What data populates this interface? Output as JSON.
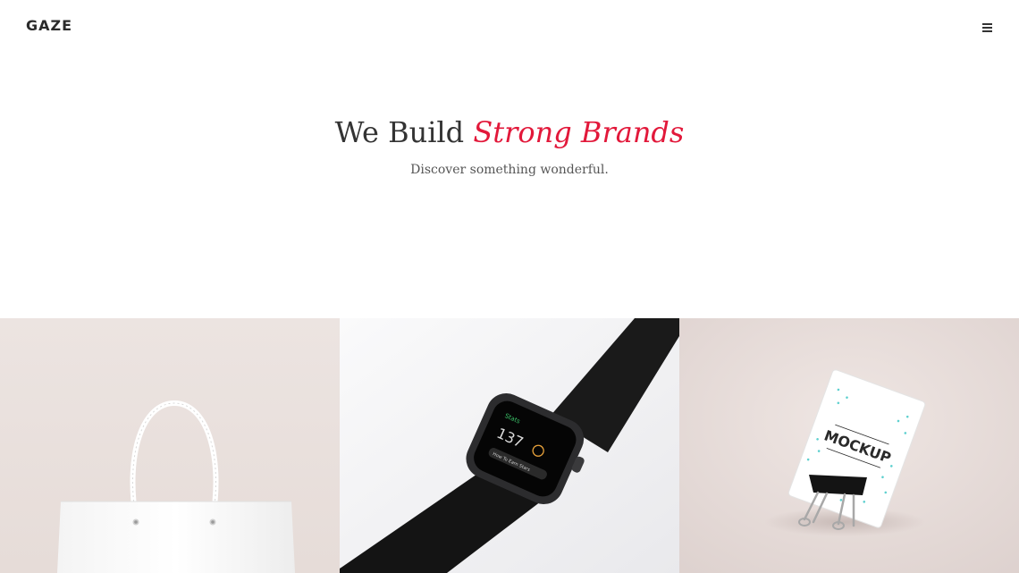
{
  "header": {
    "logo": "GAZE",
    "menu_icon": "hamburger-menu-icon"
  },
  "hero": {
    "title_plain": "We Build ",
    "title_accent": "Strong Brands",
    "subtitle": "Discover something wonderful."
  },
  "colors": {
    "accent": "#e2183a",
    "text": "#333333",
    "tile_1_bg": "#eae2df",
    "tile_2_bg": "#f2f2f4",
    "tile_3_bg": "#e6dcd9"
  },
  "portfolio": {
    "items": [
      {
        "image": "shopping-bag-image"
      },
      {
        "image": "smartwatch-image",
        "screen_label": "Stats",
        "screen_value": "137",
        "screen_button": "How To Earn Stars"
      },
      {
        "image": "business-card-mockup-image",
        "card_text": "MOCKUP"
      }
    ]
  }
}
